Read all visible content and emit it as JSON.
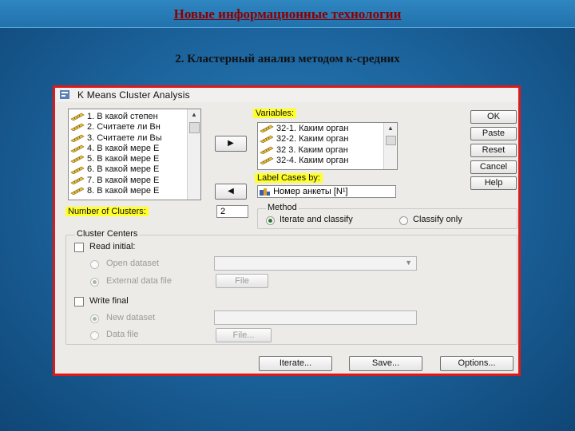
{
  "slide": {
    "title": "Новые информационные технологии",
    "subtitle": "2. Кластерный анализ методом к-средних"
  },
  "dialog": {
    "title": "K Means Cluster Analysis",
    "source_list": [
      "1. В какой степен",
      "2. Считаете ли Вн",
      "3. Считаете ли Вы",
      "4. В какой мере Е",
      "5. В какой мере Е",
      "6. В какой мере Е",
      "7. В какой мере Е",
      "8. В какой мере Е"
    ],
    "variables_label": "Variables:",
    "variables_list": [
      "32-1. Каким орган",
      "32-2. Каким орган",
      "32 3. Каким орган",
      "32-4. Каким орган"
    ],
    "label_cases_label": "Label Cases by:",
    "label_cases_value": "Номер анкеты [N¹]",
    "number_of_clusters_label": "Number of Clusters:",
    "number_of_clusters_value": "2",
    "method_label": "Method",
    "method_iterate": "Iterate and classify",
    "method_classify": "Classify only",
    "cluster_centers_label": "Cluster Centers",
    "read_initial_label": "Read initial:",
    "open_dataset_label": "Open dataset",
    "external_data_file_label": "External data file",
    "file_button_1": "File",
    "write_final_label": "Write final",
    "new_dataset_label": "New dataset",
    "data_file_label": "Data file",
    "file_button_2": "File...",
    "buttons": {
      "ok": "OK",
      "paste": "Paste",
      "reset": "Reset",
      "cancel": "Cancel",
      "help": "Help",
      "iterate": "Iterate...",
      "save": "Save...",
      "options": "Options..."
    },
    "arrow_right": "▶",
    "arrow_left": "◀"
  },
  "colors": {
    "highlight": "#ffff2a",
    "dialog_border": "#e01818",
    "title_text": "#8b0000"
  }
}
